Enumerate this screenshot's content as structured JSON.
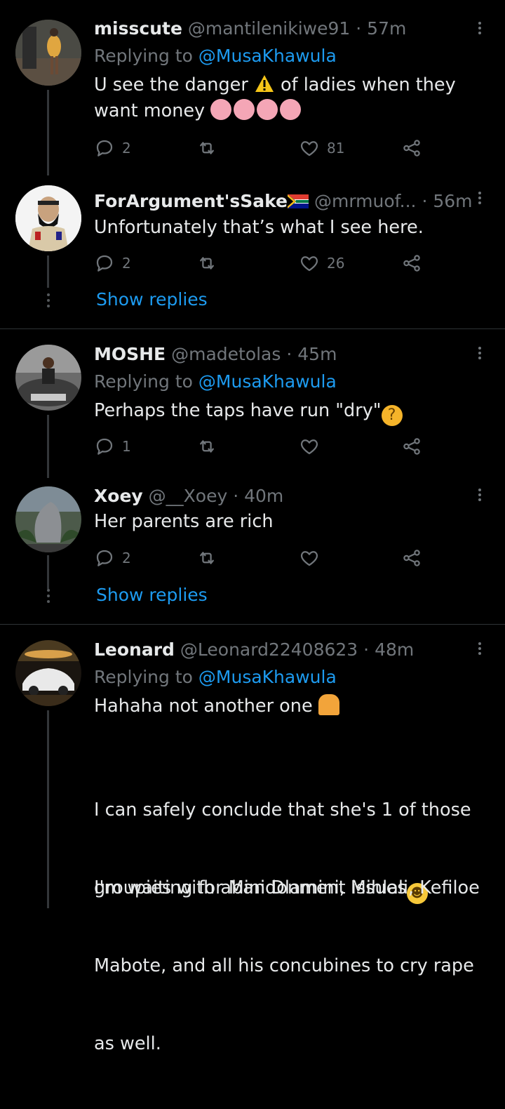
{
  "colors": {
    "background": "#000000",
    "accent": "#1d9bf0",
    "muted": "#71767b",
    "text": "#e7e9ea",
    "divider": "#2f3336"
  },
  "tweets": [
    {
      "name": "misscute",
      "handle": "@mantilenikiwe91",
      "time": "· 57m",
      "replying_label": "Replying to",
      "replying_to": "@MusaKhawula",
      "text_part1": "U see the danger ",
      "text_part2": " of ladies when they want money ",
      "replies": "2",
      "likes": "81"
    },
    {
      "name": "ForArgument'sSake",
      "handle": "@mrmuof...",
      "time": "· 56m",
      "text": "Unfortunately that’s what I see here.",
      "replies": "2",
      "likes": "26",
      "show_replies": "Show replies"
    },
    {
      "name": "MOSHE",
      "handle": "@madetolas",
      "time": "· 45m",
      "replying_label": "Replying to",
      "replying_to": "@MusaKhawula",
      "text": "Perhaps the taps have run \"dry\"",
      "replies": "1"
    },
    {
      "name": "Xoey",
      "handle": "@__Xoey",
      "time": "· 40m",
      "text": "Her parents are rich",
      "replies": "2",
      "show_replies": "Show replies"
    },
    {
      "name": "Leonard",
      "handle": "@Leonard22408623",
      "time": "· 48m",
      "replying_label": "Replying to",
      "replying_to": "@MusaKhawula",
      "para1": "Hahaha not another one",
      "para2a": "I can safely conclude that she's 1 of those",
      "para2b": "groupies with abandonment issues",
      "para3a": "I'm waiting for Mini Dlamini, Mihlali, Kefiloe",
      "para3b": "Mabote, and all his concubines to cry rape",
      "para3c": "as well."
    }
  ],
  "icons": {
    "reply": "reply-icon",
    "retweet": "retweet-icon",
    "like": "heart-icon",
    "share": "share-icon",
    "more": "more-vertical-icon"
  }
}
